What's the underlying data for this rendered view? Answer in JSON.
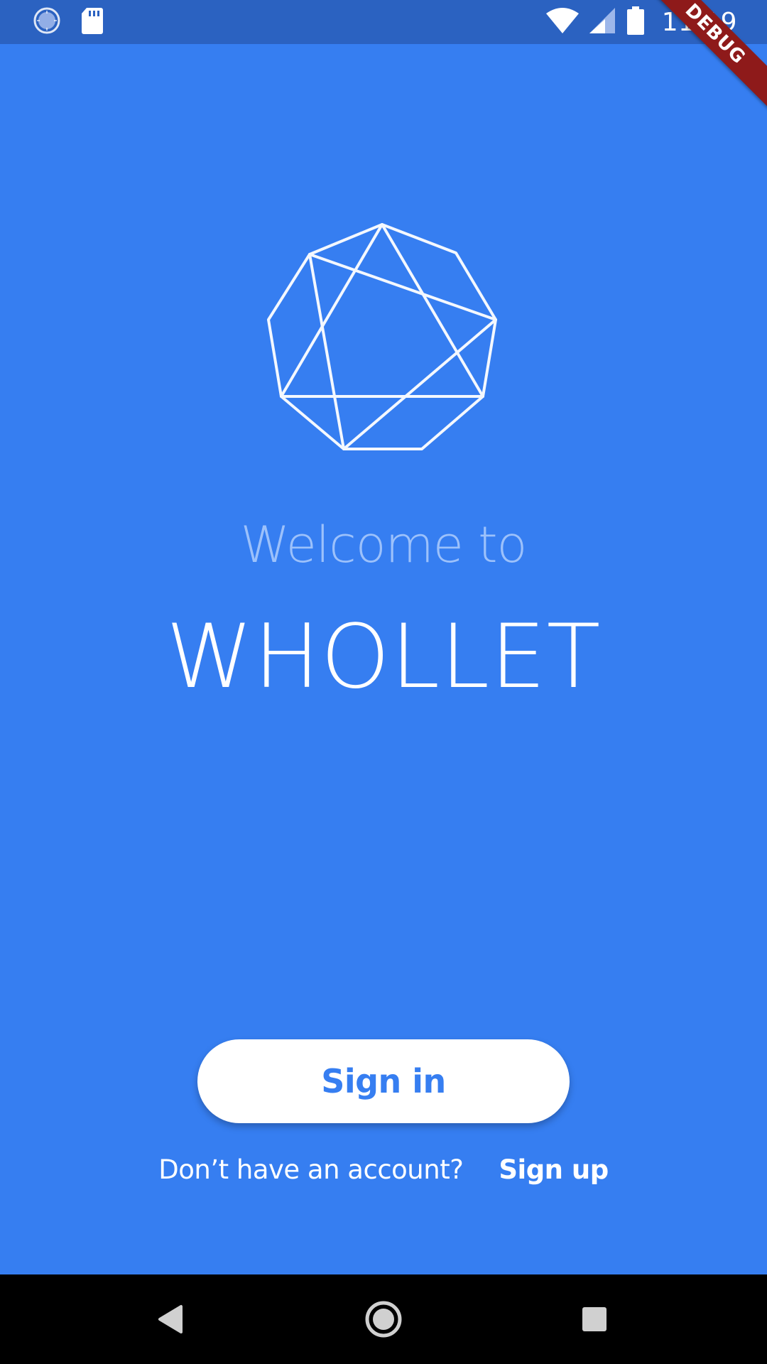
{
  "status_bar": {
    "time": "11:19",
    "icons": [
      "sync-icon",
      "sd-card-icon",
      "wifi-icon",
      "signal-icon",
      "battery-icon"
    ]
  },
  "debug_banner": {
    "label": "DEBUG"
  },
  "welcome": {
    "greeting": "Welcome to",
    "app_name": "WHOLLET"
  },
  "actions": {
    "sign_in_label": "Sign in",
    "signup_prompt": "Don’t have an account?",
    "signup_label": "Sign up"
  },
  "nav_bar": {
    "icons": [
      "back-icon",
      "home-icon",
      "recents-icon"
    ]
  },
  "colors": {
    "background": "#367EF1",
    "status_bar": "#2B62C1",
    "button_text": "#367EF1",
    "welcome_text": "#9CC1FB",
    "debug_banner": "#8E1A1A"
  }
}
